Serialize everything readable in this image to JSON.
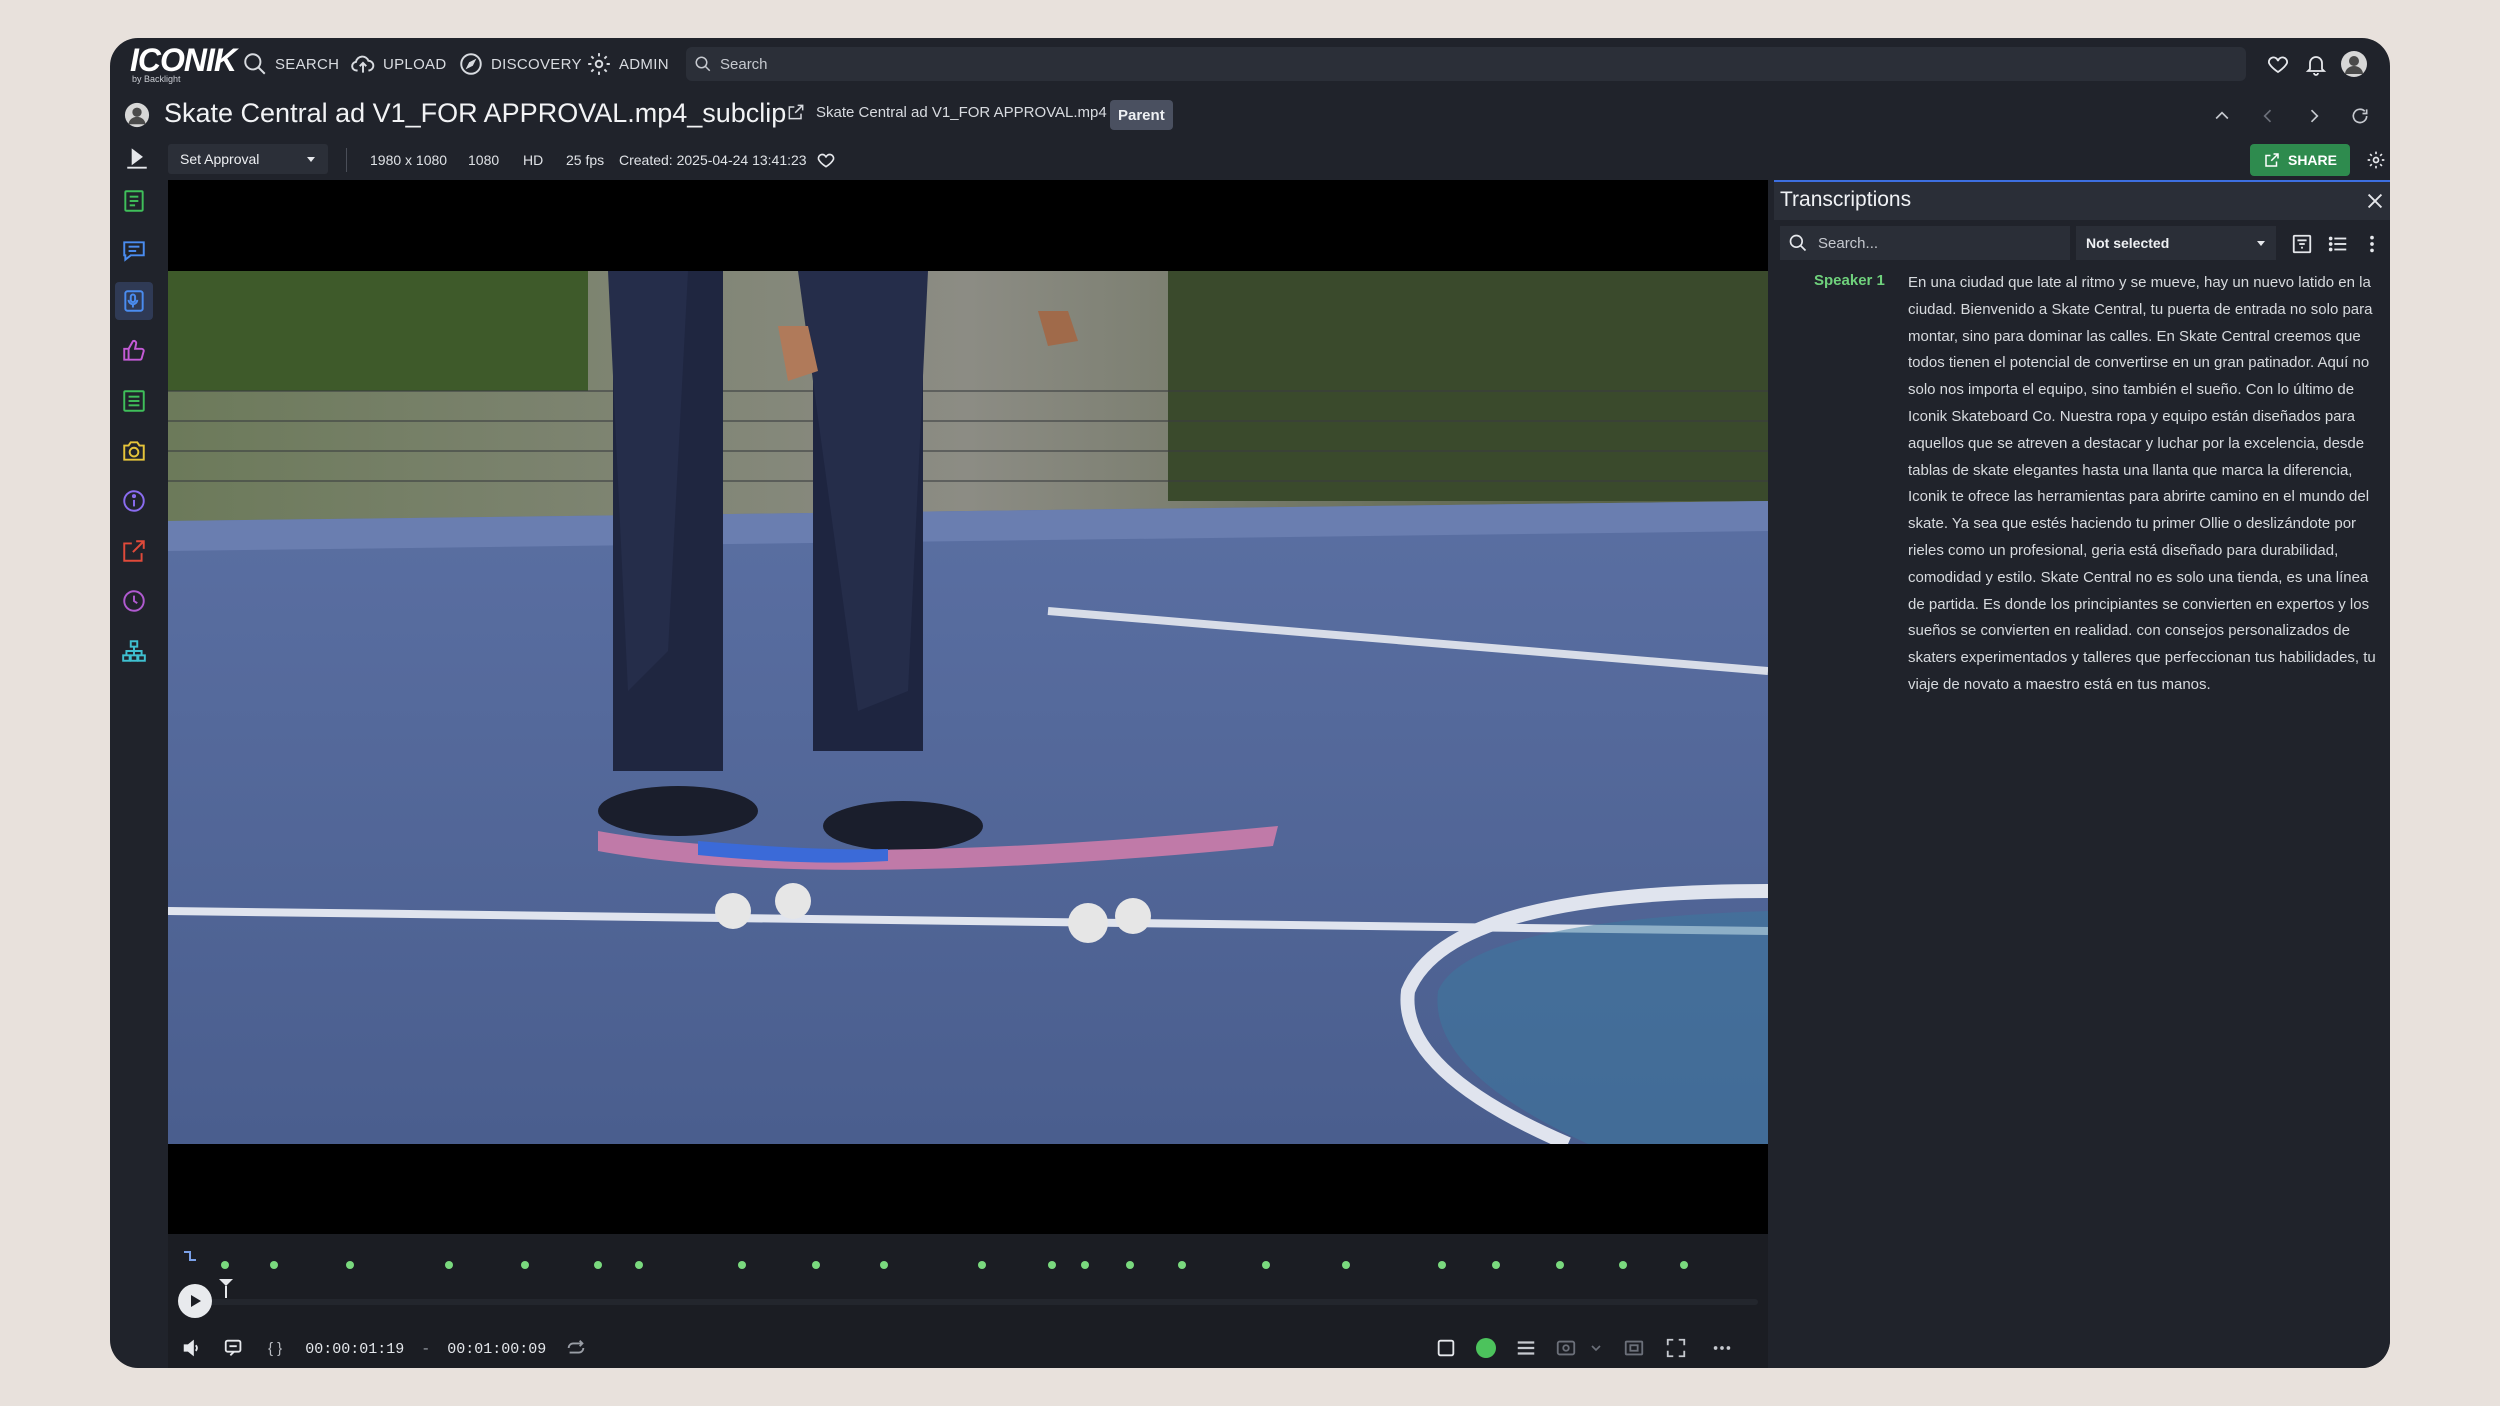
{
  "app": {
    "logo_text": "ICONIK",
    "logo_sub": "by Backlight"
  },
  "nav": {
    "items": [
      {
        "label": "SEARCH",
        "icon": "search-icon"
      },
      {
        "label": "UPLOAD",
        "icon": "cloud-upload-icon"
      },
      {
        "label": "DISCOVERY",
        "icon": "compass-icon"
      },
      {
        "label": "ADMIN",
        "icon": "gear-icon"
      }
    ],
    "search_placeholder": "Search"
  },
  "asset": {
    "title": "Skate Central ad V1_FOR APPROVAL.mp4_subclip",
    "parent_name": "Skate Central ad V1_FOR APPROVAL.mp4",
    "parent_badge": "Parent"
  },
  "meta": {
    "approval": "Set Approval",
    "resolution": "1980 x 1080",
    "height": "1080",
    "quality": "HD",
    "fps": "25 fps",
    "created": "Created: 2025-04-24 13:41:23",
    "share_label": "SHARE"
  },
  "sidebar": {
    "items": [
      {
        "name": "metadata",
        "icon": "document-lines-icon",
        "color": "#3fbf5a"
      },
      {
        "name": "comments",
        "icon": "comment-icon",
        "color": "#4a8cf0"
      },
      {
        "name": "transcriptions",
        "icon": "transcription-icon",
        "color": "#4a8cf0",
        "active": true
      },
      {
        "name": "approvals",
        "icon": "thumbs-up-icon",
        "color": "#c45bd6"
      },
      {
        "name": "versions",
        "icon": "list-document-icon",
        "color": "#3fbf5a"
      },
      {
        "name": "snapshots",
        "icon": "camera-icon",
        "color": "#e6c43a"
      },
      {
        "name": "info",
        "icon": "info-icon",
        "color": "#8a6cf0"
      },
      {
        "name": "export",
        "icon": "export-icon",
        "color": "#e04a3a"
      },
      {
        "name": "history",
        "icon": "history-icon",
        "color": "#b05ad0"
      },
      {
        "name": "relations",
        "icon": "hierarchy-icon",
        "color": "#3fc0d0"
      }
    ]
  },
  "player": {
    "in_point": "00:00:01:19",
    "separator": "-",
    "out_point": "00:01:00:09",
    "brackets": "{ }"
  },
  "transcriptions": {
    "title": "Transcriptions",
    "search_placeholder": "Search...",
    "speaker_filter": "Not selected",
    "speaker": "Speaker 1",
    "text": "En una ciudad que late al ritmo y se mueve, hay un nuevo latido en la ciudad. Bienvenido a Skate Central, tu puerta de entrada no solo para montar, sino para dominar las calles. En Skate Central creemos que todos tienen el potencial de convertirse en un gran patinador. Aquí no solo nos importa el equipo, sino también el sueño. Con lo último de Iconik Skateboard Co. Nuestra ropa y equipo están diseñados para aquellos que se atreven a destacar y luchar por la excelencia, desde tablas de skate elegantes hasta una llanta que marca la diferencia, Iconik te ofrece las herramientas para abrirte camino en el mundo del skate. Ya sea que estés haciendo tu primer Ollie o deslizándote por rieles como un profesional, geria está diseñado para durabilidad, comodidad y estilo. Skate Central no es solo una tienda, es una línea de partida. Es donde los principiantes se convierten en expertos y los sueños se convierten en realidad. con consejos personalizados de skaters experimentados y talleres que perfeccionan tus habilidades, tu viaje de novato a maestro está en tus manos."
  }
}
